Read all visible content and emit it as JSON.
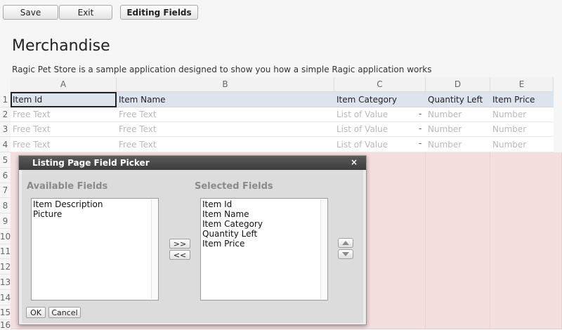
{
  "toolbar": {
    "save_label": "Save",
    "exit_label": "Exit",
    "editing_fields_label": "Editing Fields"
  },
  "sheet": {
    "title": "Merchandise",
    "description": "Ragic Pet Store is a sample application designed to show you how a simple Ragic application works",
    "columns": [
      "A",
      "B",
      "C",
      "D",
      "E"
    ],
    "row_numbers": [
      "1",
      "2",
      "3",
      "4",
      "5",
      "6",
      "7",
      "8",
      "9",
      "10",
      "11",
      "12",
      "13",
      "14",
      "15",
      "16"
    ],
    "header_fields": [
      "Item Id",
      "Item Name",
      "Item Category",
      "Quantity Left",
      "Item Price"
    ],
    "placeholder_rows": [
      [
        "Free Text",
        "Free Text",
        "List of Value",
        "Number",
        "Number"
      ],
      [
        "Free Text",
        "Free Text",
        "List of Value",
        "Number",
        "Number"
      ],
      [
        "Free Text",
        "Free Text",
        "List of Value",
        "Number",
        "Number"
      ]
    ],
    "dash": "-"
  },
  "dialog": {
    "title": "Listing Page Field Picker",
    "close": "×",
    "available_label": "Available Fields",
    "selected_label": "Selected Fields",
    "available_fields": [
      "Item Description",
      "Picture"
    ],
    "selected_fields": [
      "Item Id",
      "Item Name",
      "Item Category",
      "Quantity Left",
      "Item Price"
    ],
    "add_label": ">>",
    "remove_label": "<<",
    "ok_label": "OK",
    "cancel_label": "Cancel"
  },
  "colors": {
    "header_row": "#dde4ee",
    "pink_area": "#f4dede",
    "dialog_title_bar": "#4a4a4a"
  }
}
